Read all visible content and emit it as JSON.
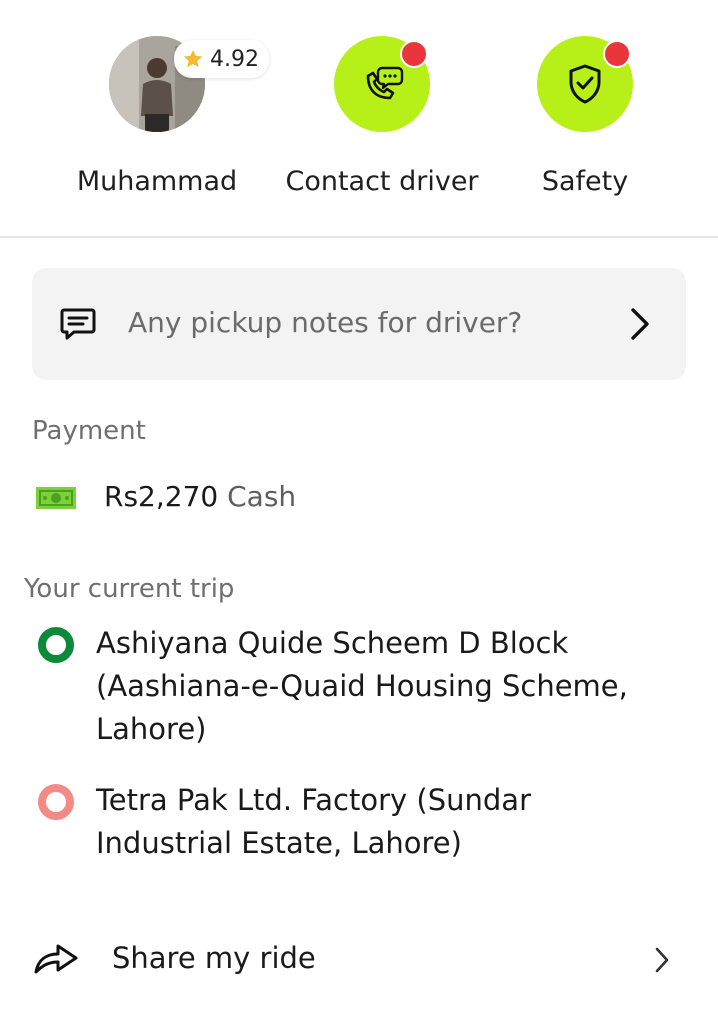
{
  "driver": {
    "name": "Muhammad",
    "rating": "4.92",
    "rating_icon": "star-icon"
  },
  "actions": {
    "contact_label": "Contact driver",
    "contact_icon": "phone-chat-icon",
    "safety_label": "Safety",
    "safety_icon": "shield-check-icon"
  },
  "colors": {
    "accent_lime": "#b7f019",
    "notification_red": "#e8363a",
    "pickup_green": "#0a8a3a",
    "dropoff_pink": "#f28a86",
    "cash_green": "#7bd13a"
  },
  "notes": {
    "placeholder": "Any pickup notes for driver?",
    "icon": "message-icon"
  },
  "payment": {
    "section_label": "Payment",
    "amount": "Rs2,270",
    "method": "Cash",
    "icon": "cash-icon"
  },
  "trip": {
    "section_label": "Your current trip",
    "pickup_lines": [
      "Ashiyana Quide Scheem D Block",
      "(Aashiana-e-Quaid Housing Scheme,",
      "Lahore)"
    ],
    "dropoff_lines": [
      "Tetra Pak Ltd. Factory (Sundar",
      "Industrial Estate, Lahore)"
    ]
  },
  "share": {
    "label": "Share my ride",
    "icon": "share-arrow-icon"
  }
}
